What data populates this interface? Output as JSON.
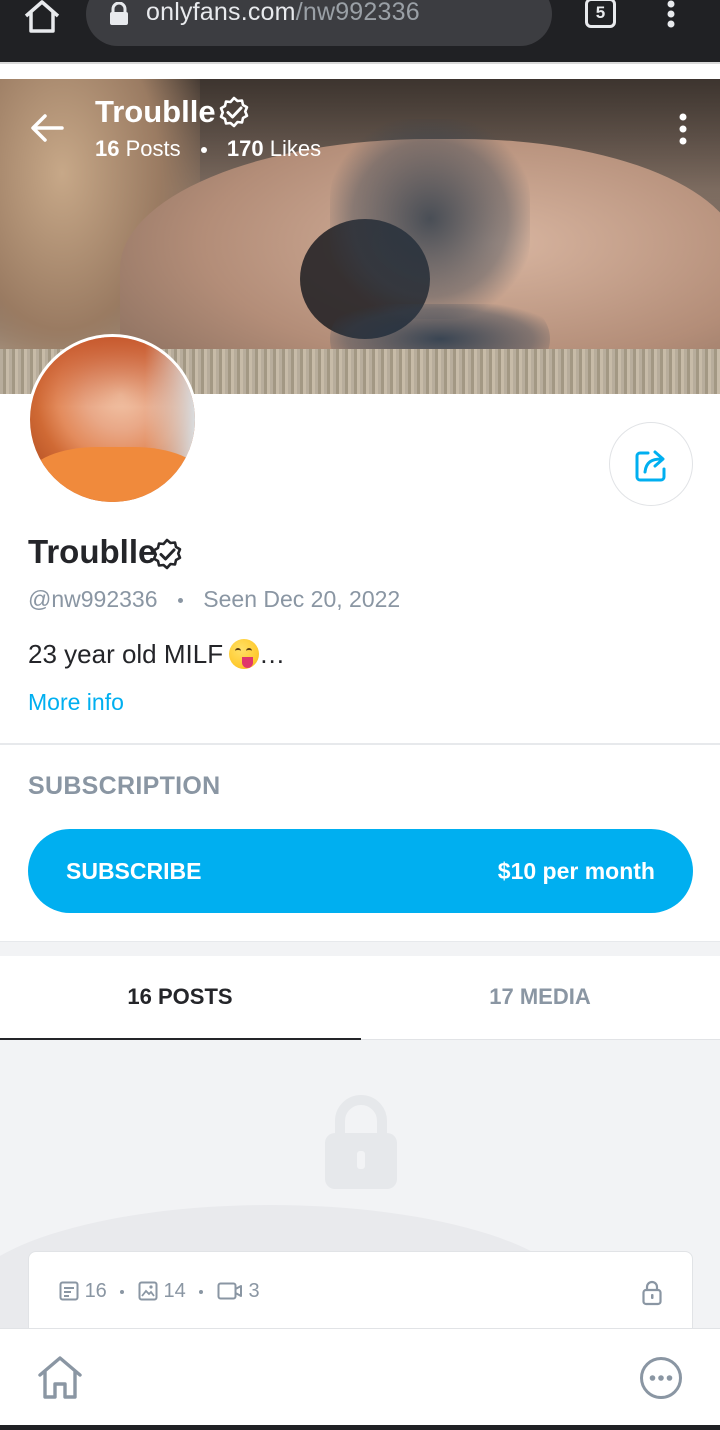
{
  "browser": {
    "url_host": "onlyfans.com",
    "url_path": "/nw992336",
    "tab_count": "5"
  },
  "cover": {
    "name": "Troublle",
    "posts_count": "16",
    "posts_label": "Posts",
    "likes_count": "170",
    "likes_label": "Likes"
  },
  "profile": {
    "name": "Troublle",
    "handle": "@nw992336",
    "last_seen": "Seen Dec 20, 2022",
    "bio": "23 year old MILF",
    "bio_ellipsis": "…",
    "more_info": "More info"
  },
  "subscription": {
    "title": "SUBSCRIPTION",
    "button_label": "SUBSCRIBE",
    "price": "$10 per month"
  },
  "tabs": [
    {
      "label": "16 POSTS",
      "active": true
    },
    {
      "label": "17 MEDIA",
      "active": false
    }
  ],
  "content_counts": {
    "texts": "16",
    "photos": "14",
    "videos": "3"
  },
  "colors": {
    "accent": "#00aff0",
    "text_primary": "#242529",
    "text_secondary": "#8a96a3",
    "browser_bg": "#202124"
  }
}
